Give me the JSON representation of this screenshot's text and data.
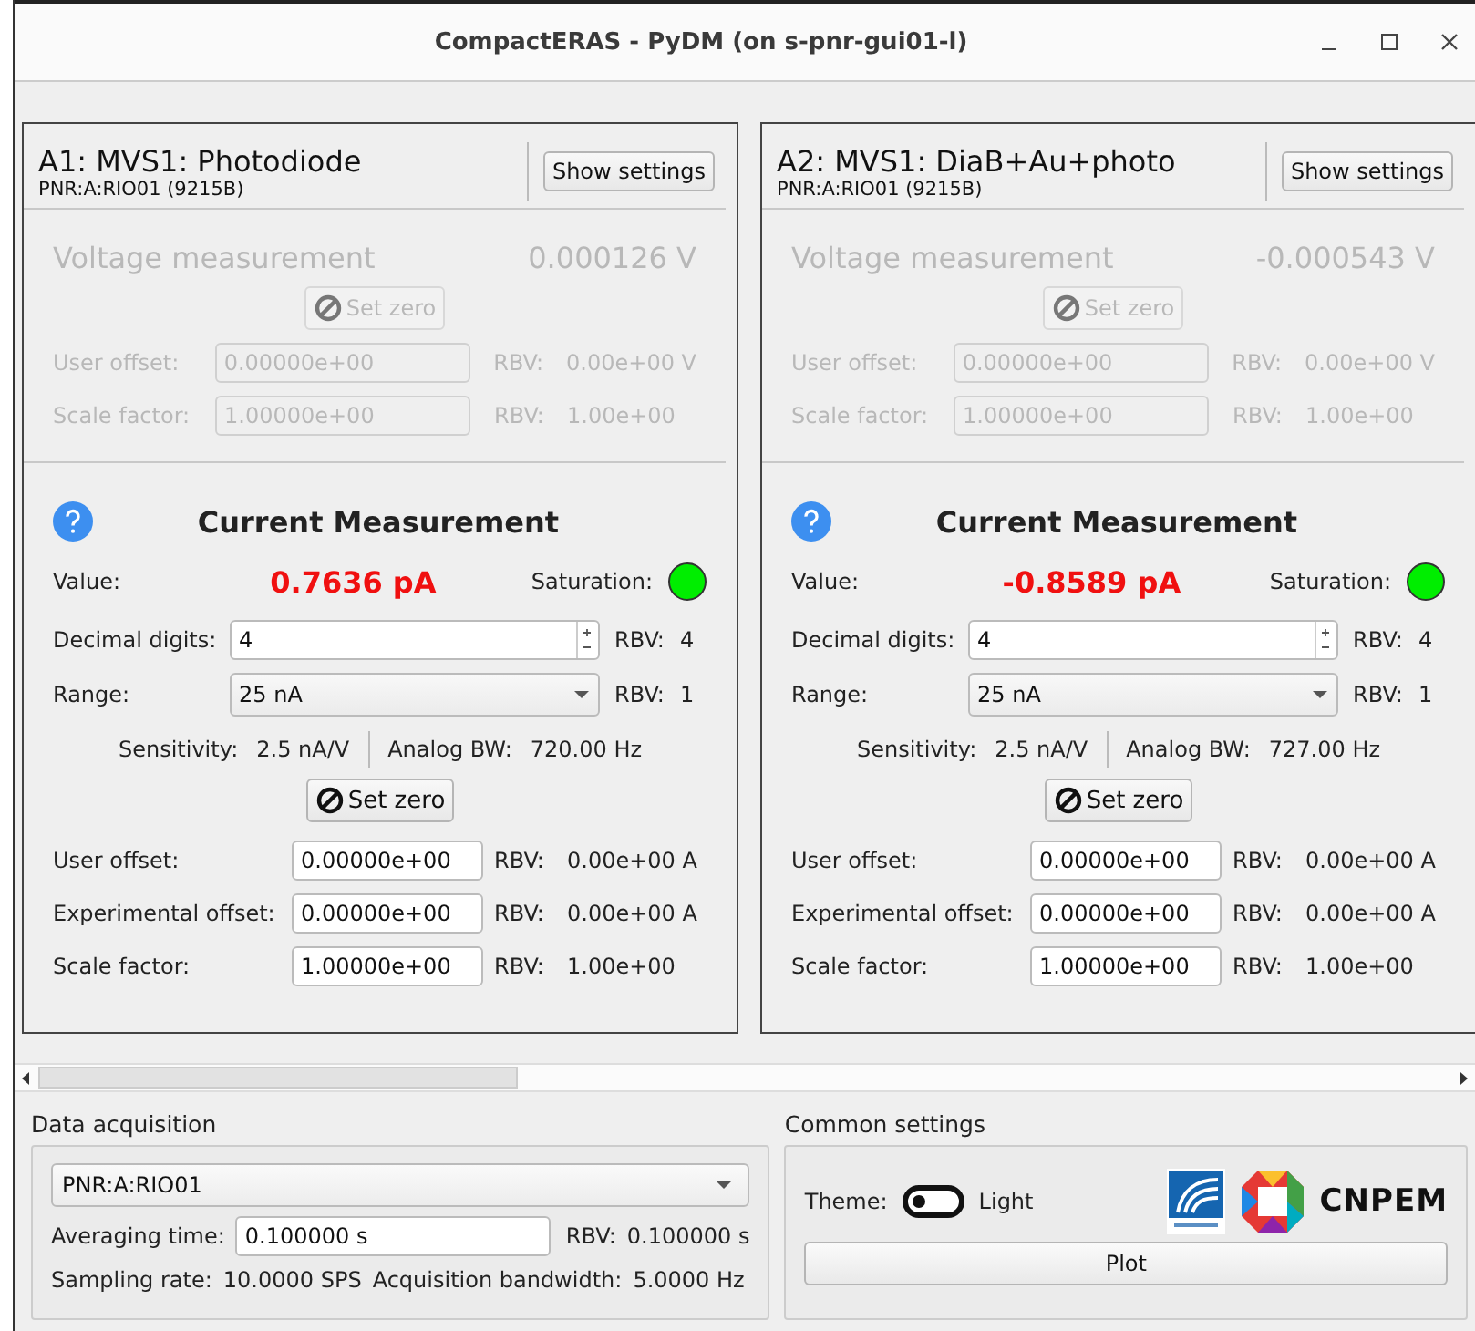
{
  "window": {
    "title": "CompactERAS - PyDM (on s-pnr-gui01-l)"
  },
  "channels": [
    {
      "title": "A1: MVS1: Photodiode",
      "pv": "PNR:A:RIO01 (9215B)",
      "settings_button": "Show settings",
      "voltage": {
        "disabled": true,
        "label": "Voltage measurement",
        "value": "0.000126 V",
        "zero_button": "Set zero",
        "rows": [
          {
            "label": "User offset:",
            "value": "0.00000e+00",
            "rbv_label": "RBV:",
            "rbv": "0.00e+00 V"
          },
          {
            "label": "Scale factor:",
            "value": "1.00000e+00",
            "rbv_label": "RBV:",
            "rbv": "1.00e+00"
          }
        ]
      },
      "current": {
        "title": "Current Measurement",
        "value_label": "Value:",
        "value": "0.7636 pA",
        "saturation_label": "Saturation:",
        "saturated": false,
        "decimal": {
          "label": "Decimal digits:",
          "value": "4",
          "rbv_label": "RBV:",
          "rbv": "4"
        },
        "range": {
          "label": "Range:",
          "value": "25 nA",
          "rbv_label": "RBV:",
          "rbv": "1"
        },
        "sensitivity_label": "Sensitivity:",
        "sensitivity": "2.5 nA/V",
        "bw_label": "Analog BW:",
        "bw": "720.00 Hz",
        "zero_button": "Set zero",
        "rows": [
          {
            "label": "User offset:",
            "value": "0.00000e+00",
            "rbv_label": "RBV:",
            "rbv": "0.00e+00 A"
          },
          {
            "label": "Experimental offset:",
            "value": "0.00000e+00",
            "rbv_label": "RBV:",
            "rbv": "0.00e+00 A"
          },
          {
            "label": "Scale factor:",
            "value": "1.00000e+00",
            "rbv_label": "RBV:",
            "rbv": "1.00e+00"
          }
        ]
      }
    },
    {
      "title": "A2: MVS1: DiaB+Au+photo",
      "pv": "PNR:A:RIO01 (9215B)",
      "settings_button": "Show settings",
      "voltage": {
        "disabled": true,
        "label": "Voltage measurement",
        "value": "-0.000543 V",
        "zero_button": "Set zero",
        "rows": [
          {
            "label": "User offset:",
            "value": "0.00000e+00",
            "rbv_label": "RBV:",
            "rbv": "0.00e+00 V"
          },
          {
            "label": "Scale factor:",
            "value": "1.00000e+00",
            "rbv_label": "RBV:",
            "rbv": "1.00e+00"
          }
        ]
      },
      "current": {
        "title": "Current Measurement",
        "value_label": "Value:",
        "value": "-0.8589 pA",
        "saturation_label": "Saturation:",
        "saturated": false,
        "decimal": {
          "label": "Decimal digits:",
          "value": "4",
          "rbv_label": "RBV:",
          "rbv": "4"
        },
        "range": {
          "label": "Range:",
          "value": "25 nA",
          "rbv_label": "RBV:",
          "rbv": "1"
        },
        "sensitivity_label": "Sensitivity:",
        "sensitivity": "2.5 nA/V",
        "bw_label": "Analog BW:",
        "bw": "727.00 Hz",
        "zero_button": "Set zero",
        "rows": [
          {
            "label": "User offset:",
            "value": "0.00000e+00",
            "rbv_label": "RBV:",
            "rbv": "0.00e+00 A"
          },
          {
            "label": "Experimental offset:",
            "value": "0.00000e+00",
            "rbv_label": "RBV:",
            "rbv": "0.00e+00 A"
          },
          {
            "label": "Scale factor:",
            "value": "1.00000e+00",
            "rbv_label": "RBV:",
            "rbv": "1.00e+00"
          }
        ]
      }
    }
  ],
  "data_acquisition": {
    "title": "Data acquisition",
    "device": "PNR:A:RIO01",
    "averaging_label": "Averaging time:",
    "averaging": "0.100000 s",
    "rbv_label": "RBV:",
    "rbv": "0.100000 s",
    "sampling_label": "Sampling rate:",
    "sampling": "10.0000 SPS",
    "bandwidth_label": "Acquisition bandwidth:",
    "bandwidth": "5.0000 Hz"
  },
  "common_settings": {
    "title": "Common settings",
    "theme_label": "Theme:",
    "theme_dark": false,
    "theme_value": "Light",
    "logo_text": "CNPEM",
    "plot_button": "Plot"
  }
}
